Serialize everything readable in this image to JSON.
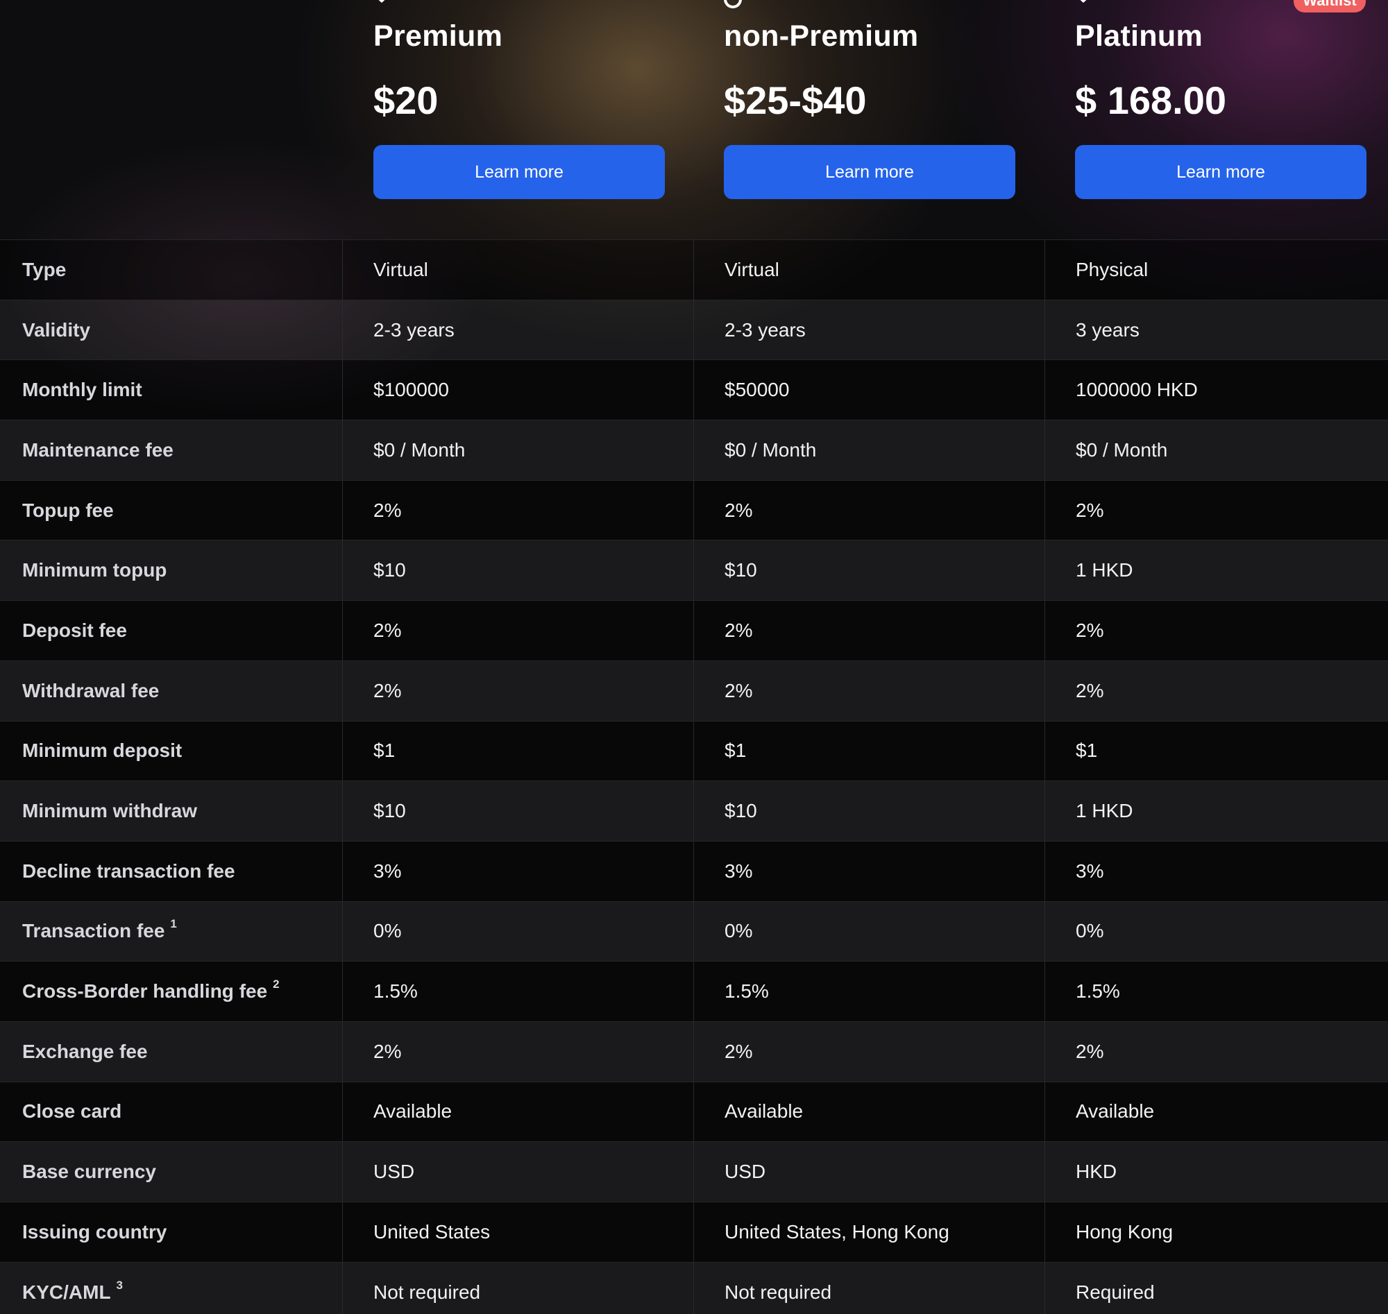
{
  "colors": {
    "background": "#0d0d0f",
    "button": "#2563eb",
    "badge": "#f06060",
    "label_text": "#d8d8dc"
  },
  "badge": {
    "label": "Waitlist"
  },
  "plans": [
    {
      "name": "Premium",
      "price": "$20",
      "button_label": "Learn more",
      "icon": "shield-icon"
    },
    {
      "name": "non-Premium",
      "price": "$25-$40",
      "button_label": "Learn more",
      "icon": "ring-icon"
    },
    {
      "name": "Platinum",
      "price": "$ 168.00",
      "button_label": "Learn more",
      "icon": "shield-icon"
    }
  ],
  "table": {
    "rows": [
      {
        "label": "Type",
        "sup": "",
        "values": [
          "Virtual",
          "Virtual",
          "Physical"
        ]
      },
      {
        "label": "Validity",
        "sup": "",
        "values": [
          "2-3 years",
          "2-3 years",
          "3 years"
        ]
      },
      {
        "label": "Monthly limit",
        "sup": "",
        "values": [
          "$100000",
          "$50000",
          "1000000 HKD"
        ]
      },
      {
        "label": "Maintenance fee",
        "sup": "",
        "values": [
          "$0 / Month",
          "$0 / Month",
          "$0 / Month"
        ]
      },
      {
        "label": "Topup fee",
        "sup": "",
        "values": [
          "2%",
          "2%",
          "2%"
        ]
      },
      {
        "label": "Minimum topup",
        "sup": "",
        "values": [
          "$10",
          "$10",
          "1 HKD"
        ]
      },
      {
        "label": "Deposit fee",
        "sup": "",
        "values": [
          "2%",
          "2%",
          "2%"
        ]
      },
      {
        "label": "Withdrawal fee",
        "sup": "",
        "values": [
          "2%",
          "2%",
          "2%"
        ]
      },
      {
        "label": "Minimum deposit",
        "sup": "",
        "values": [
          "$1",
          "$1",
          "$1"
        ]
      },
      {
        "label": "Minimum withdraw",
        "sup": "",
        "values": [
          "$10",
          "$10",
          "1 HKD"
        ]
      },
      {
        "label": "Decline transaction fee",
        "sup": "",
        "values": [
          "3%",
          "3%",
          "3%"
        ]
      },
      {
        "label": "Transaction fee",
        "sup": "1",
        "values": [
          "0%",
          "0%",
          "0%"
        ]
      },
      {
        "label": "Cross-Border handling fee",
        "sup": "2",
        "values": [
          "1.5%",
          "1.5%",
          "1.5%"
        ]
      },
      {
        "label": "Exchange fee",
        "sup": "",
        "values": [
          "2%",
          "2%",
          "2%"
        ]
      },
      {
        "label": "Close card",
        "sup": "",
        "values": [
          "Available",
          "Available",
          "Available"
        ]
      },
      {
        "label": "Base currency",
        "sup": "",
        "values": [
          "USD",
          "USD",
          "HKD"
        ]
      },
      {
        "label": "Issuing country",
        "sup": "",
        "values": [
          "United States",
          "United States, Hong Kong",
          "Hong Kong"
        ]
      },
      {
        "label": "KYC/AML",
        "sup": "3",
        "values": [
          "Not required",
          "Not required",
          "Required"
        ]
      }
    ]
  }
}
